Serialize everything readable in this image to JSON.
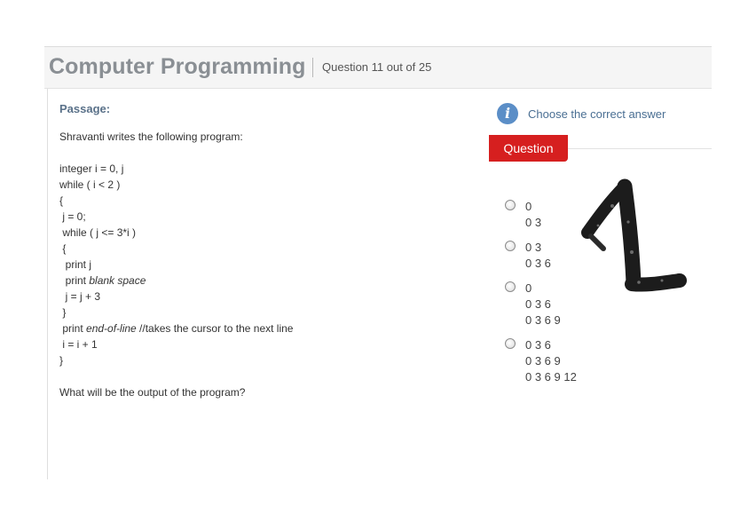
{
  "header": {
    "title": "Computer Programming",
    "question_counter": "Question 11 out of 25"
  },
  "passage": {
    "label": "Passage:",
    "intro": "Shravanti writes the following program:",
    "code": [
      "integer i = 0, j",
      "while ( i < 2 )",
      "{",
      " j = 0;",
      " while ( j <= 3*i )",
      " {",
      "  print j",
      "  print ",
      "  j = j + 3",
      " }",
      " print ",
      " i = i + 1",
      "}"
    ],
    "code_italic": {
      "blank_space": "blank space",
      "end_of_line": "end-of-line",
      "comment": " //takes the cursor to the next line"
    },
    "question": "What will be the output of the program?"
  },
  "panel": {
    "info_icon": "info-icon",
    "instruction": "Choose the correct answer",
    "tab_label": "Question",
    "options": [
      {
        "lines": [
          "0",
          "0 3"
        ]
      },
      {
        "lines": [
          "0 3",
          "0 3 6"
        ]
      },
      {
        "lines": [
          "0",
          "0 3 6",
          "0 3 6 9"
        ]
      },
      {
        "lines": [
          "0 3 6",
          "0 3 6 9",
          "0 3 6 9 12"
        ]
      }
    ]
  },
  "annotation": {
    "text": "1",
    "icon": "handwritten-one-icon"
  }
}
